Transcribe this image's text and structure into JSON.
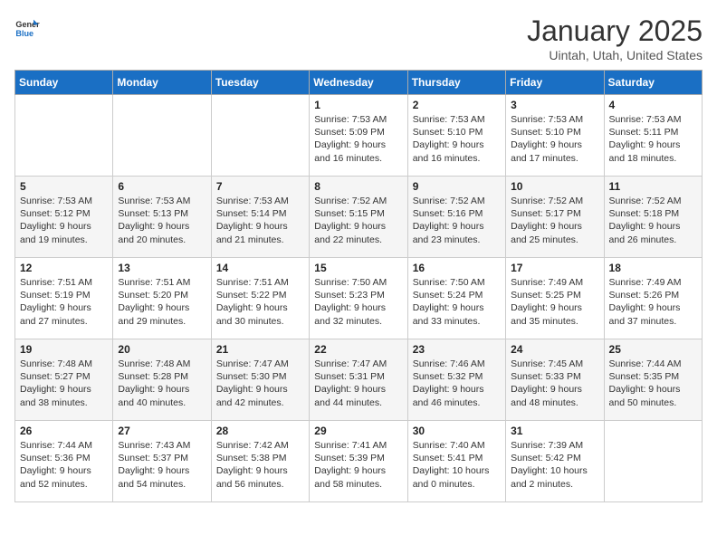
{
  "header": {
    "logo_line1": "General",
    "logo_line2": "Blue",
    "month": "January 2025",
    "location": "Uintah, Utah, United States"
  },
  "weekdays": [
    "Sunday",
    "Monday",
    "Tuesday",
    "Wednesday",
    "Thursday",
    "Friday",
    "Saturday"
  ],
  "weeks": [
    [
      null,
      null,
      null,
      {
        "day": "1",
        "sunrise": "7:53 AM",
        "sunset": "5:09 PM",
        "daylight": "9 hours and 16 minutes."
      },
      {
        "day": "2",
        "sunrise": "7:53 AM",
        "sunset": "5:10 PM",
        "daylight": "9 hours and 16 minutes."
      },
      {
        "day": "3",
        "sunrise": "7:53 AM",
        "sunset": "5:10 PM",
        "daylight": "9 hours and 17 minutes."
      },
      {
        "day": "4",
        "sunrise": "7:53 AM",
        "sunset": "5:11 PM",
        "daylight": "9 hours and 18 minutes."
      }
    ],
    [
      {
        "day": "5",
        "sunrise": "7:53 AM",
        "sunset": "5:12 PM",
        "daylight": "9 hours and 19 minutes."
      },
      {
        "day": "6",
        "sunrise": "7:53 AM",
        "sunset": "5:13 PM",
        "daylight": "9 hours and 20 minutes."
      },
      {
        "day": "7",
        "sunrise": "7:53 AM",
        "sunset": "5:14 PM",
        "daylight": "9 hours and 21 minutes."
      },
      {
        "day": "8",
        "sunrise": "7:52 AM",
        "sunset": "5:15 PM",
        "daylight": "9 hours and 22 minutes."
      },
      {
        "day": "9",
        "sunrise": "7:52 AM",
        "sunset": "5:16 PM",
        "daylight": "9 hours and 23 minutes."
      },
      {
        "day": "10",
        "sunrise": "7:52 AM",
        "sunset": "5:17 PM",
        "daylight": "9 hours and 25 minutes."
      },
      {
        "day": "11",
        "sunrise": "7:52 AM",
        "sunset": "5:18 PM",
        "daylight": "9 hours and 26 minutes."
      }
    ],
    [
      {
        "day": "12",
        "sunrise": "7:51 AM",
        "sunset": "5:19 PM",
        "daylight": "9 hours and 27 minutes."
      },
      {
        "day": "13",
        "sunrise": "7:51 AM",
        "sunset": "5:20 PM",
        "daylight": "9 hours and 29 minutes."
      },
      {
        "day": "14",
        "sunrise": "7:51 AM",
        "sunset": "5:22 PM",
        "daylight": "9 hours and 30 minutes."
      },
      {
        "day": "15",
        "sunrise": "7:50 AM",
        "sunset": "5:23 PM",
        "daylight": "9 hours and 32 minutes."
      },
      {
        "day": "16",
        "sunrise": "7:50 AM",
        "sunset": "5:24 PM",
        "daylight": "9 hours and 33 minutes."
      },
      {
        "day": "17",
        "sunrise": "7:49 AM",
        "sunset": "5:25 PM",
        "daylight": "9 hours and 35 minutes."
      },
      {
        "day": "18",
        "sunrise": "7:49 AM",
        "sunset": "5:26 PM",
        "daylight": "9 hours and 37 minutes."
      }
    ],
    [
      {
        "day": "19",
        "sunrise": "7:48 AM",
        "sunset": "5:27 PM",
        "daylight": "9 hours and 38 minutes."
      },
      {
        "day": "20",
        "sunrise": "7:48 AM",
        "sunset": "5:28 PM",
        "daylight": "9 hours and 40 minutes."
      },
      {
        "day": "21",
        "sunrise": "7:47 AM",
        "sunset": "5:30 PM",
        "daylight": "9 hours and 42 minutes."
      },
      {
        "day": "22",
        "sunrise": "7:47 AM",
        "sunset": "5:31 PM",
        "daylight": "9 hours and 44 minutes."
      },
      {
        "day": "23",
        "sunrise": "7:46 AM",
        "sunset": "5:32 PM",
        "daylight": "9 hours and 46 minutes."
      },
      {
        "day": "24",
        "sunrise": "7:45 AM",
        "sunset": "5:33 PM",
        "daylight": "9 hours and 48 minutes."
      },
      {
        "day": "25",
        "sunrise": "7:44 AM",
        "sunset": "5:35 PM",
        "daylight": "9 hours and 50 minutes."
      }
    ],
    [
      {
        "day": "26",
        "sunrise": "7:44 AM",
        "sunset": "5:36 PM",
        "daylight": "9 hours and 52 minutes."
      },
      {
        "day": "27",
        "sunrise": "7:43 AM",
        "sunset": "5:37 PM",
        "daylight": "9 hours and 54 minutes."
      },
      {
        "day": "28",
        "sunrise": "7:42 AM",
        "sunset": "5:38 PM",
        "daylight": "9 hours and 56 minutes."
      },
      {
        "day": "29",
        "sunrise": "7:41 AM",
        "sunset": "5:39 PM",
        "daylight": "9 hours and 58 minutes."
      },
      {
        "day": "30",
        "sunrise": "7:40 AM",
        "sunset": "5:41 PM",
        "daylight": "10 hours and 0 minutes."
      },
      {
        "day": "31",
        "sunrise": "7:39 AM",
        "sunset": "5:42 PM",
        "daylight": "10 hours and 2 minutes."
      },
      null
    ]
  ]
}
